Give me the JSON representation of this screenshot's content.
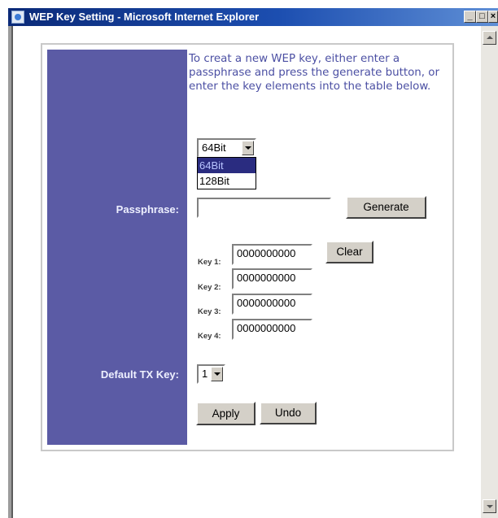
{
  "window": {
    "title": "WEP Key Setting - Microsoft Internet Explorer",
    "controls": {
      "minimize": "_",
      "maximize": "□",
      "close": "×"
    }
  },
  "intro_text": "To creat a new WEP key, either enter a passphrase and press the generate button, or enter the key elements into the table below.",
  "key_length": {
    "selected": "64Bit",
    "options": [
      "64Bit",
      "128Bit"
    ]
  },
  "passphrase": {
    "label": "Passphrase:",
    "value": ""
  },
  "generate_button": "Generate",
  "keys": [
    {
      "label": "Key 1:",
      "value": "0000000000"
    },
    {
      "label": "Key 2:",
      "value": "0000000000"
    },
    {
      "label": "Key 3:",
      "value": "0000000000"
    },
    {
      "label": "Key 4:",
      "value": "0000000000"
    }
  ],
  "clear_button": "Clear",
  "default_tx_key": {
    "label": "Default TX Key:",
    "value": "1"
  },
  "apply_button": "Apply",
  "undo_button": "Undo",
  "colors": {
    "sidebar": "#5b5ba5",
    "intro_text": "#4b4fa3",
    "titlebar": "#0b2a78",
    "selected_option": "#2a2c80"
  }
}
